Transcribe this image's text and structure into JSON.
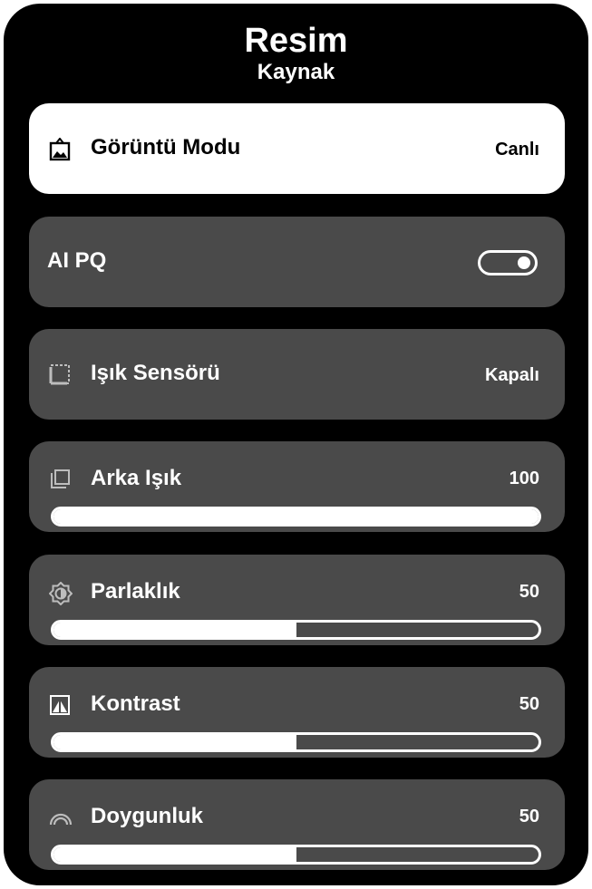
{
  "header": {
    "title": "Resim",
    "subtitle": "Kaynak"
  },
  "menu": {
    "items": [
      {
        "label": "Görüntü Modu",
        "value": "Canlı",
        "icon": "picture-mode-icon"
      },
      {
        "label": "AI PQ",
        "toggle": true,
        "icon": ""
      },
      {
        "label": "Işık Sensörü",
        "value": "Kapalı",
        "icon": "light-sensor-icon"
      },
      {
        "label": "Arka Işık",
        "value": "100",
        "level": 100,
        "icon": "backlight-icon"
      },
      {
        "label": "Parlaklık",
        "value": "50",
        "level": 50,
        "icon": "brightness-icon"
      },
      {
        "label": "Kontrast",
        "value": "50",
        "level": 50,
        "icon": "contrast-icon"
      },
      {
        "label": "Doygunluk",
        "value": "50",
        "level": 50,
        "icon": "saturation-icon"
      }
    ]
  },
  "colors": {
    "background": "#000000",
    "card": "#4a4a4a",
    "selected_card": "#ffffff",
    "text": "#ffffff"
  }
}
